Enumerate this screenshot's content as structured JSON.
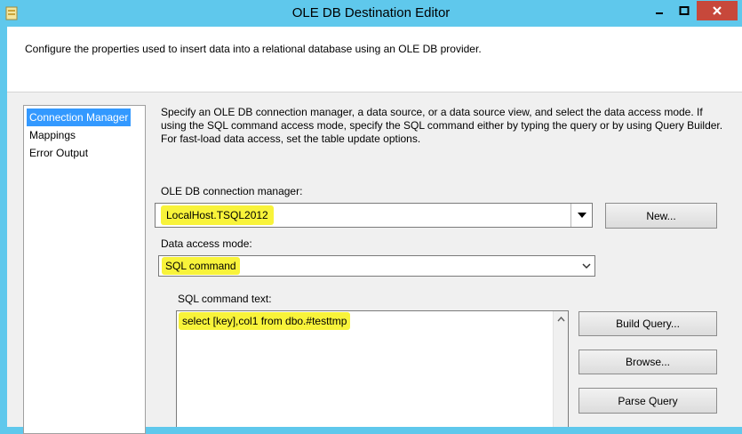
{
  "window": {
    "title": "OLE DB Destination Editor",
    "description": "Configure the properties used to insert data into a relational database using an OLE DB provider."
  },
  "nav": {
    "items": [
      {
        "label": "Connection Manager",
        "selected": true
      },
      {
        "label": "Mappings",
        "selected": false
      },
      {
        "label": "Error Output",
        "selected": false
      }
    ]
  },
  "page": {
    "description": "Specify an OLE DB connection manager, a data source, or a data source view, and select the data access mode. If using the SQL command access mode, specify the SQL command either by typing the query or by using Query Builder. For fast-load data access, set the table update options.",
    "connection_label": "OLE DB connection manager:",
    "connection_value": "LocalHost.TSQL2012",
    "new_button": "New...",
    "access_mode_label": "Data access mode:",
    "access_mode_value": "SQL command",
    "sql_label": "SQL command text:",
    "sql_text": "select [key],col1 from dbo.#testtmp",
    "build_query_button": "Build Query...",
    "browse_button": "Browse...",
    "parse_query_button": "Parse Query"
  },
  "colors": {
    "titlebar": "#5fc8ec",
    "close_button": "#c7483b",
    "highlight": "#f8f33a",
    "selection": "#3399ff"
  },
  "icons": {
    "app": "ssis-component-icon",
    "minimize": "minimize-icon",
    "maximize": "maximize-icon",
    "close": "close-icon",
    "dropdown": "chevron-down-icon",
    "scroll_up": "scroll-up-icon"
  }
}
